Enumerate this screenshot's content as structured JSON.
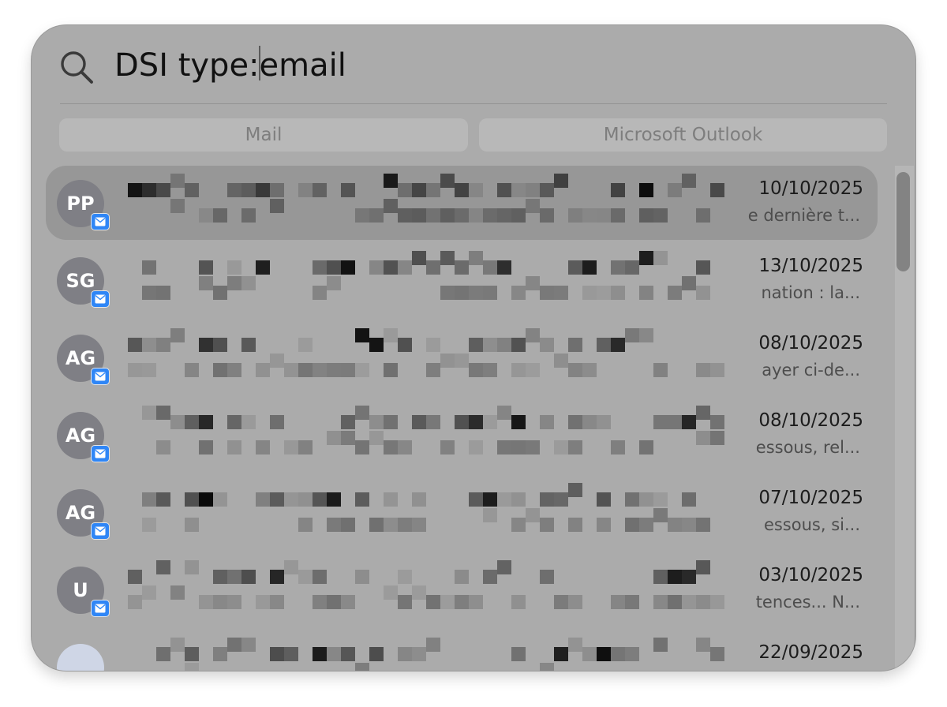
{
  "search": {
    "query_before_caret": "DSI type:",
    "query_after_caret": "email"
  },
  "scopes": [
    {
      "label": "Mail"
    },
    {
      "label": "Microsoft Outlook"
    }
  ],
  "results": [
    {
      "initials": "PP",
      "date": "10/10/2025",
      "snippet": "e dernière t...",
      "selected": true
    },
    {
      "initials": "SG",
      "date": "13/10/2025",
      "snippet": "nation : la..."
    },
    {
      "initials": "AG",
      "date": "08/10/2025",
      "snippet": "ayer ci-de..."
    },
    {
      "initials": "AG",
      "date": "08/10/2025",
      "snippet": "essous, rel..."
    },
    {
      "initials": "AG",
      "date": "07/10/2025",
      "snippet": "essous, si..."
    },
    {
      "initials": "U",
      "date": "03/10/2025",
      "snippet": "tences... N..."
    },
    {
      "initials": "",
      "date": "22/09/2025",
      "snippet": ""
    }
  ],
  "colors": {
    "panel": "#ababab",
    "selected_row": "#979797",
    "mail_badge": "#2f86f6"
  },
  "icons": {
    "search": "search-icon",
    "mail_badge": "mail-app-icon"
  }
}
